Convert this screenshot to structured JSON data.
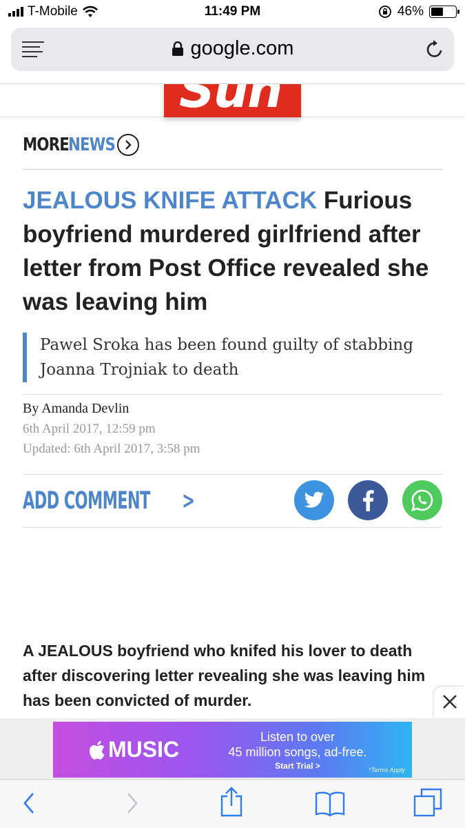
{
  "status_bar": {
    "carrier": "T-Mobile",
    "time": "11:49 PM",
    "battery_percent": "46%",
    "battery_level": 0.46
  },
  "browser": {
    "domain": "google.com",
    "menu_icon": "reader-menu-icon",
    "lock_icon": "lock-icon",
    "reload_icon": "reload-icon"
  },
  "site": {
    "logo_text": "Sun",
    "logo_color": "#e02c1f"
  },
  "more_news": {
    "more": "MORE",
    "news": "NEWS",
    "icon": "chevron-right-circle-icon"
  },
  "article": {
    "kicker": "JEALOUS KNIFE ATTACK",
    "headline": "Furious boyfriend murdered girlfriend after letter from Post Office revealed she was leaving him",
    "standfirst": "Pawel Sroka has been found guilty of stabbing Joanna Trojniak to death",
    "byline": "By Amanda Devlin",
    "published": "6th April 2017, 12:59 pm",
    "updated": "Updated: 6th April 2017, 3:58 pm",
    "body": "A JEALOUS boyfriend who knifed his lover to death after discovering letter revealing she was leaving him has been convicted of murder.",
    "accent_color": "#4e86cc"
  },
  "comments": {
    "label": "ADD COMMENT",
    "chevron": ">"
  },
  "share": {
    "twitter_color": "#3d93e0",
    "facebook_color": "#3b5998",
    "whatsapp_color": "#4ecb5c"
  },
  "ad": {
    "brand": "MUSIC",
    "line1": "Listen to over",
    "line2": "45 million songs, ad-free.",
    "cta": "Start Trial >",
    "terms": "*Terms Apply"
  },
  "toolbar": {
    "back_icon": "back-arrow-icon",
    "forward_icon": "forward-arrow-icon",
    "share_icon": "share-icon",
    "bookmarks_icon": "bookmarks-icon",
    "tabs_icon": "tabs-icon"
  }
}
